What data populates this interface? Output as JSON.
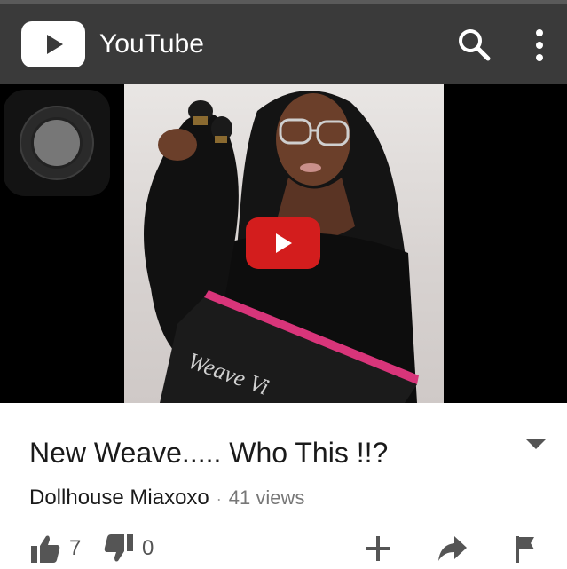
{
  "appbar": {
    "title": "YouTube",
    "logo_icon": "youtube-logo-icon",
    "search_icon": "search-icon",
    "menu_icon": "more-vertical-icon",
    "bg_color": "#3a3a3a"
  },
  "player": {
    "play_icon": "play-icon",
    "play_color": "#d31d1d",
    "thumbnail_box_text": "Weave Vi"
  },
  "video": {
    "title": "New Weave..... Who This !!?",
    "channel": "Dollhouse Miaxoxo",
    "separator": "·",
    "views": "41 views"
  },
  "actions": {
    "likes": "7",
    "dislikes": "0",
    "like_icon": "thumbs-up-icon",
    "dislike_icon": "thumbs-down-icon",
    "add_icon": "add-to-playlist-icon",
    "share_icon": "share-icon",
    "flag_icon": "flag-icon"
  }
}
